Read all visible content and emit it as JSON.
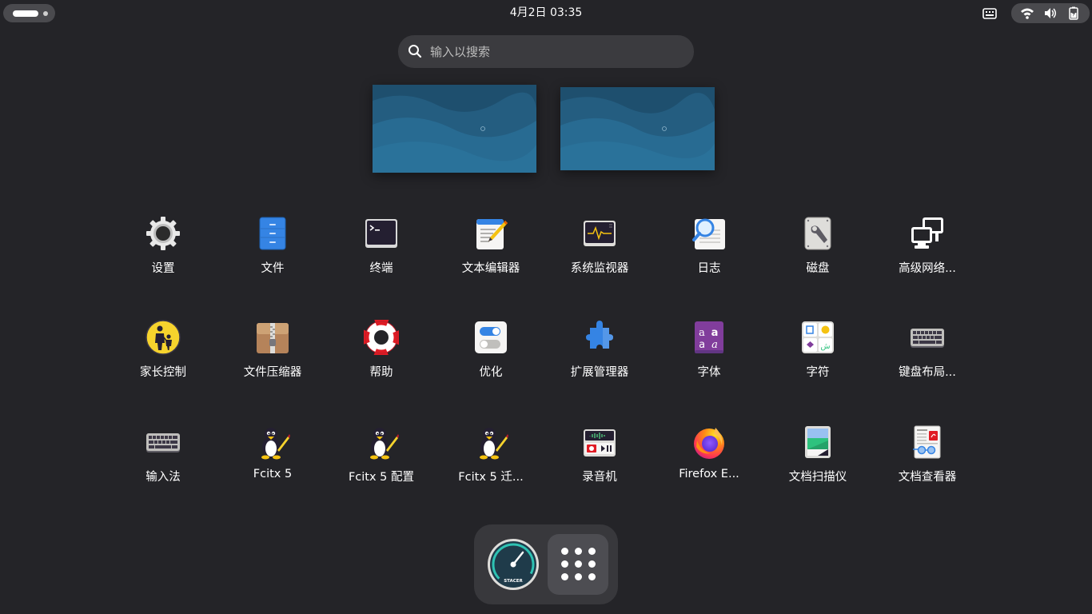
{
  "topbar": {
    "clock": "4月2日  03:35"
  },
  "search": {
    "placeholder": "输入以搜索"
  },
  "apps": [
    {
      "label": "设置",
      "icon": "settings-gear-icon"
    },
    {
      "label": "文件",
      "icon": "files-icon"
    },
    {
      "label": "终端",
      "icon": "terminal-icon"
    },
    {
      "label": "文本编辑器",
      "icon": "text-editor-icon"
    },
    {
      "label": "系统监视器",
      "icon": "system-monitor-icon"
    },
    {
      "label": "日志",
      "icon": "logs-icon"
    },
    {
      "label": "磁盘",
      "icon": "disks-icon"
    },
    {
      "label": "高级网络...",
      "icon": "network-icon"
    },
    {
      "label": "家长控制",
      "icon": "parental-controls-icon"
    },
    {
      "label": "文件压缩器",
      "icon": "archive-manager-icon"
    },
    {
      "label": "帮助",
      "icon": "help-lifebuoy-icon"
    },
    {
      "label": "优化",
      "icon": "tweaks-icon"
    },
    {
      "label": "扩展管理器",
      "icon": "extensions-puzzle-icon"
    },
    {
      "label": "字体",
      "icon": "fonts-icon"
    },
    {
      "label": "字符",
      "icon": "characters-icon"
    },
    {
      "label": "键盘布局...",
      "icon": "keyboard-layout-icon"
    },
    {
      "label": "输入法",
      "icon": "input-method-keyboard-icon"
    },
    {
      "label": "Fcitx 5",
      "icon": "fcitx-penguin-icon"
    },
    {
      "label": "Fcitx 5 配置",
      "icon": "fcitx-config-penguin-icon"
    },
    {
      "label": "Fcitx 5 迁...",
      "icon": "fcitx-migrator-penguin-icon"
    },
    {
      "label": "录音机",
      "icon": "sound-recorder-icon"
    },
    {
      "label": "Firefox E...",
      "icon": "firefox-icon"
    },
    {
      "label": "文档扫描仪",
      "icon": "document-scanner-icon"
    },
    {
      "label": "文档查看器",
      "icon": "document-viewer-icon"
    }
  ],
  "dock": {
    "stacer_text": "STACER"
  },
  "colors": {
    "background": "#242428",
    "panel_pill": "#4a4a4e",
    "search_bg": "#3b3b3f",
    "dock_bg": "#38383c",
    "wallpaper_blue": "#236a8e"
  }
}
